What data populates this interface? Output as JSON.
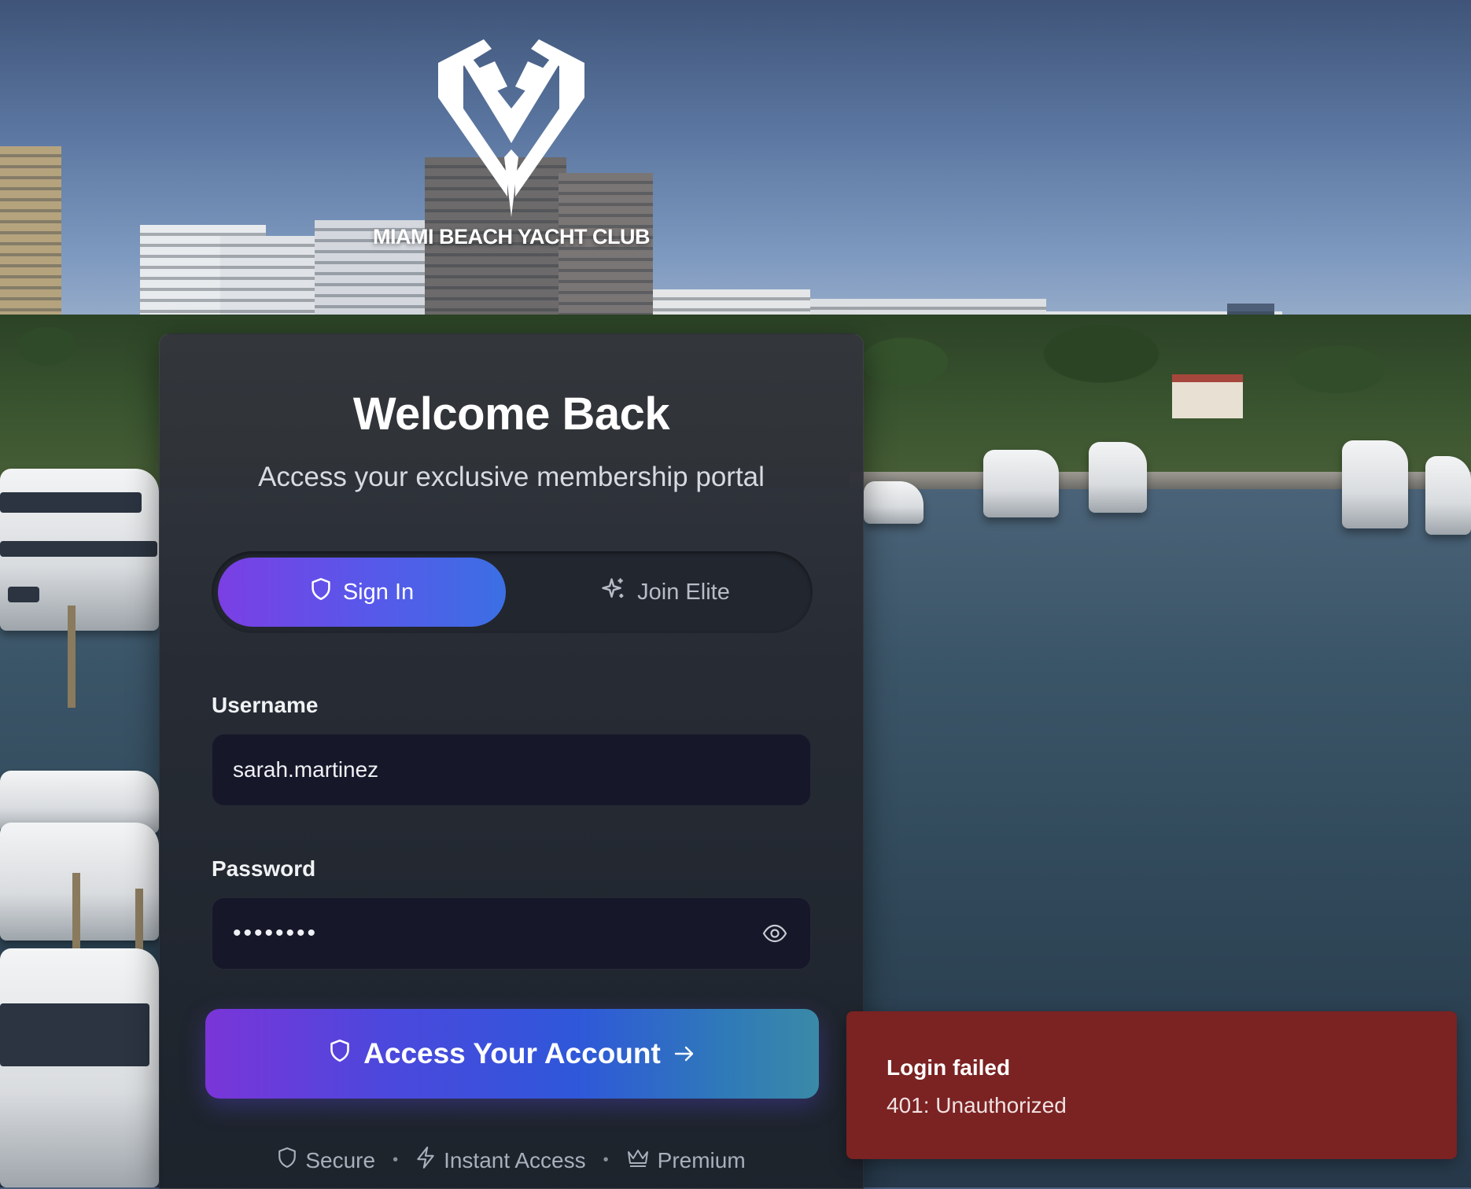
{
  "brand": {
    "name": "MIAMI BEACH YACHT CLUB",
    "logo_icon": "mb-monogram-logo"
  },
  "login": {
    "title": "Welcome Back",
    "subtitle": "Access your exclusive membership portal",
    "tabs": [
      {
        "label": "Sign In",
        "icon": "shield-icon",
        "active": true
      },
      {
        "label": "Join Elite",
        "icon": "sparkle-icon",
        "active": false
      }
    ],
    "username": {
      "label": "Username",
      "value": "sarah.martinez"
    },
    "password": {
      "label": "Password",
      "value": "••••••••",
      "toggle_icon": "eye-icon"
    },
    "submit": {
      "label": "Access Your Account",
      "icon": "shield-icon",
      "trailing_icon": "arrow-right-icon"
    },
    "badges": [
      {
        "label": "Secure",
        "icon": "shield-icon"
      },
      {
        "label": "Instant Access",
        "icon": "lightning-icon"
      },
      {
        "label": "Premium",
        "icon": "crown-icon"
      }
    ],
    "badge_separator": "•"
  },
  "toast": {
    "title": "Login failed",
    "message": "401: Unauthorized",
    "color": "#7b2222"
  },
  "colors": {
    "accent_start": "#7b3fe4",
    "accent_end": "#3b6fe4",
    "input_bg": "#161728"
  }
}
